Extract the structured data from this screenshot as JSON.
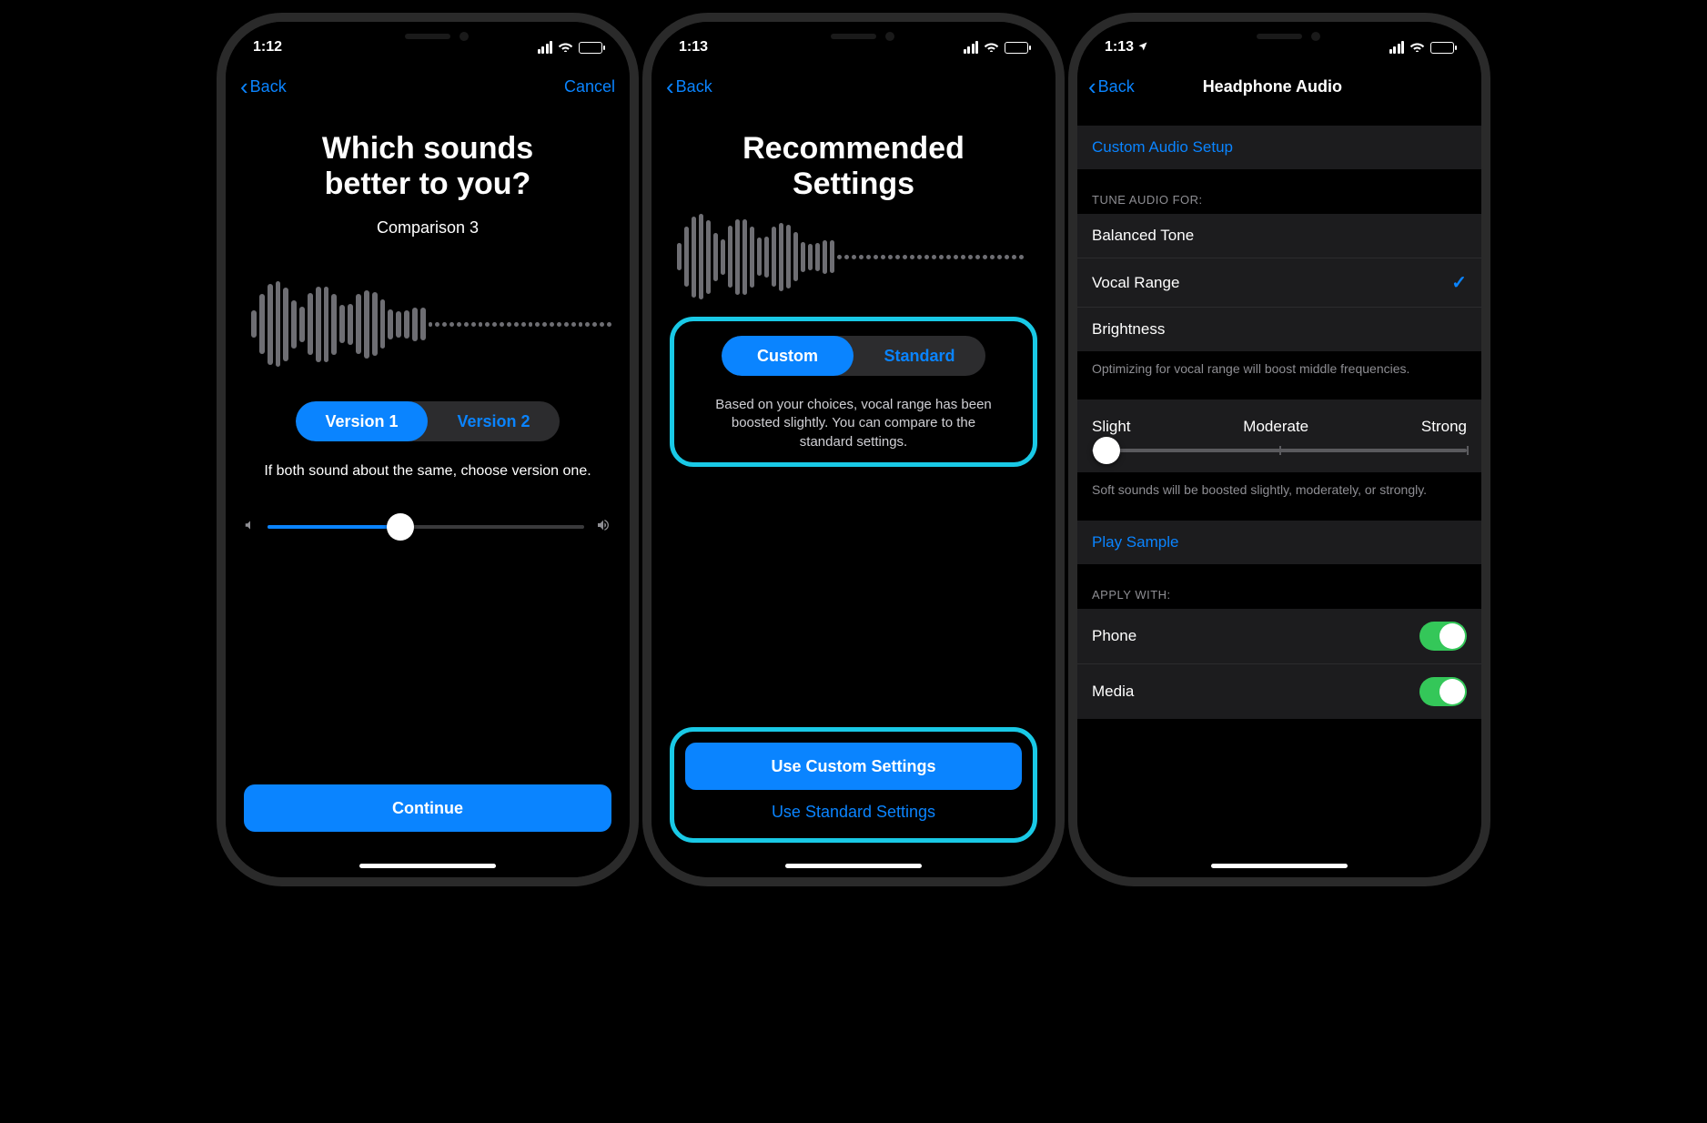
{
  "accent": "#0a84ff",
  "highlight": "#19c9e6",
  "screen1": {
    "status_time": "1:12",
    "back_label": "Back",
    "cancel_label": "Cancel",
    "title_line1": "Which sounds",
    "title_line2": "better to you?",
    "comparison_label": "Comparison 3",
    "version1_label": "Version 1",
    "version2_label": "Version 2",
    "hint": "If both sound about the same, choose version one.",
    "continue_label": "Continue",
    "volume_percent": 42
  },
  "screen2": {
    "status_time": "1:13",
    "back_label": "Back",
    "title_line1": "Recommended",
    "title_line2": "Settings",
    "seg_custom": "Custom",
    "seg_standard": "Standard",
    "description": "Based on your choices, vocal range has been boosted slightly. You can compare to the standard settings.",
    "use_custom": "Use Custom Settings",
    "use_standard": "Use Standard Settings"
  },
  "screen3": {
    "status_time": "1:13",
    "back_label": "Back",
    "page_title": "Headphone Audio",
    "custom_setup": "Custom Audio Setup",
    "tune_header": "TUNE AUDIO FOR:",
    "tune_options": {
      "balanced": "Balanced Tone",
      "vocal": "Vocal Range",
      "brightness": "Brightness"
    },
    "tune_selected": "vocal",
    "tune_footer": "Optimizing for vocal range will boost middle frequencies.",
    "strength_labels": {
      "slight": "Slight",
      "moderate": "Moderate",
      "strong": "Strong"
    },
    "strength_value": 0,
    "strength_footer": "Soft sounds will be boosted slightly, moderately, or strongly.",
    "play_sample": "Play Sample",
    "apply_header": "APPLY WITH:",
    "apply_phone": "Phone",
    "apply_media": "Media",
    "phone_on": true,
    "media_on": true
  }
}
